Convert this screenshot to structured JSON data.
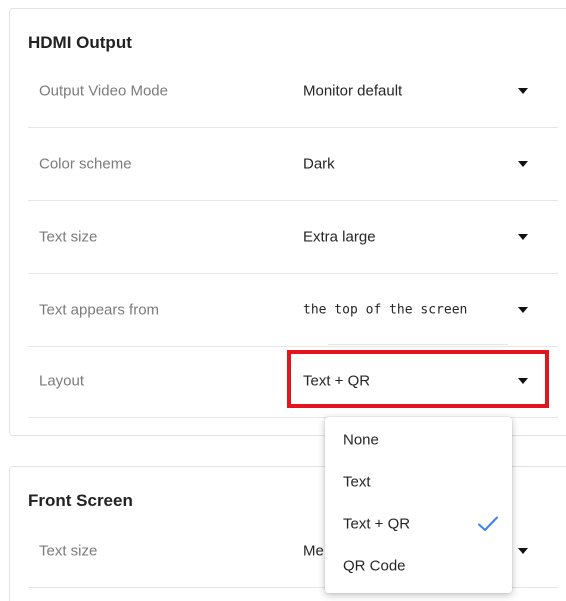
{
  "hdmi_output": {
    "title": "HDMI Output",
    "rows": [
      {
        "label": "Output Video Mode",
        "value": "Monitor default"
      },
      {
        "label": "Color scheme",
        "value": "Dark"
      },
      {
        "label": "Text size",
        "value": "Extra large"
      },
      {
        "label": "Text appears from",
        "value": "the top of the screen"
      },
      {
        "label": "Layout",
        "value": "Text + QR"
      }
    ]
  },
  "layout_dropdown": {
    "options": [
      "None",
      "Text",
      "Text + QR",
      "QR Code"
    ],
    "selected": "Text + QR"
  },
  "front_screen": {
    "title": "Front Screen",
    "rows": [
      {
        "label": "Text size",
        "value": "Me"
      }
    ]
  },
  "colors": {
    "highlight_border": "#e3141e",
    "check_icon": "#3b82f6",
    "label_text": "#7b7b7b",
    "value_text": "#262626"
  },
  "icons": {
    "dropdown_caret": "caret-down-icon",
    "selected_marker": "check-icon"
  }
}
